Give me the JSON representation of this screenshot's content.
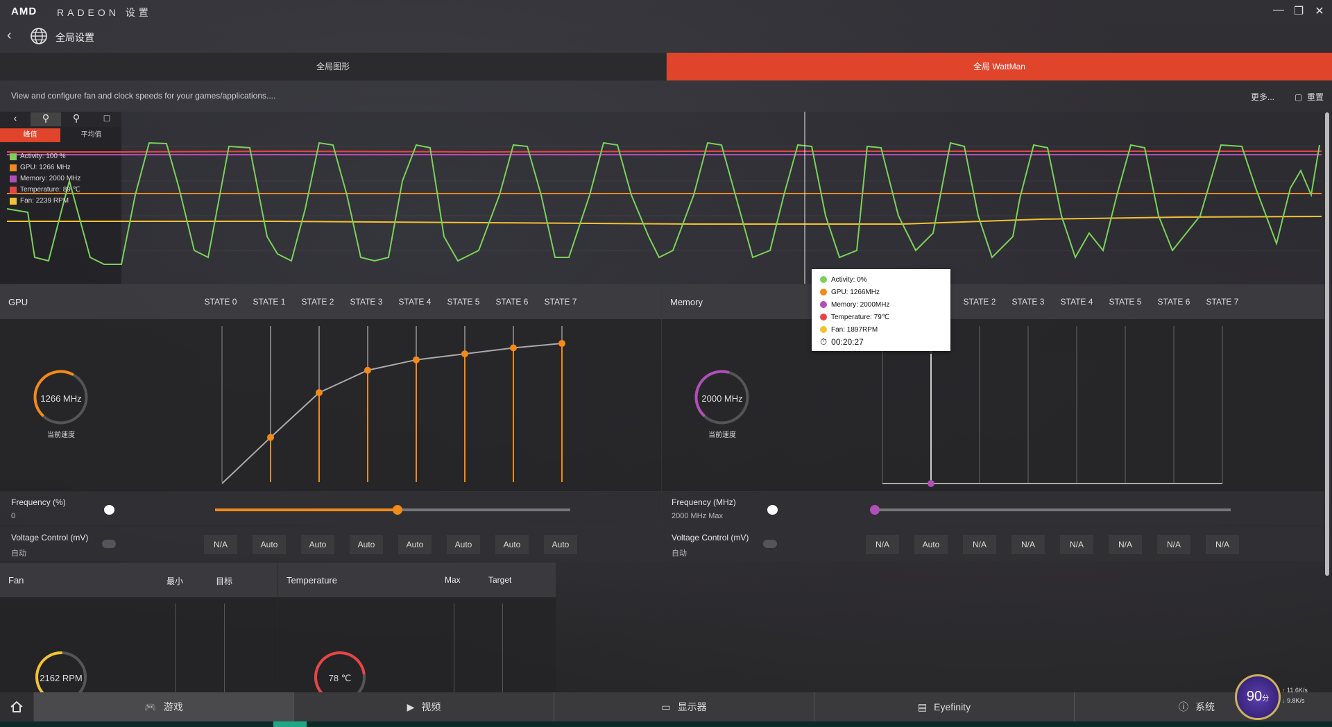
{
  "app": {
    "brand": "AMD",
    "name": "RADEON",
    "settings_label": "设置",
    "page_title": "全局设置"
  },
  "tabs": [
    {
      "label": "全局图形",
      "active": false
    },
    {
      "label": "全局 WattMan",
      "active": true
    }
  ],
  "description": "View and configure fan and clock speeds for your games/applications....",
  "toolbar": {
    "more": "更多...",
    "reset": "重置"
  },
  "graph": {
    "modes": [
      {
        "label": "峰值",
        "active": true
      },
      {
        "label": "平均值",
        "active": false
      }
    ],
    "legend": [
      {
        "label": "Activity: 100 %",
        "color": "#7bd15a"
      },
      {
        "label": "GPU: 1266 MHz",
        "color": "#f28a1a"
      },
      {
        "label": "Memory: 2000 MHz",
        "color": "#b04fb8"
      },
      {
        "label": "Temperature: 89 ℃",
        "color": "#e64545"
      },
      {
        "label": "Fan: 2239 RPM",
        "color": "#f2c232"
      }
    ],
    "tooltip": [
      {
        "label": "Activity: 0%",
        "color": "#7bd15a"
      },
      {
        "label": "GPU: 1266MHz",
        "color": "#f28a1a"
      },
      {
        "label": "Memory: 2000MHz",
        "color": "#b04fb8"
      },
      {
        "label": "Temperature: 79℃",
        "color": "#e64545"
      },
      {
        "label": "Fan: 1897RPM",
        "color": "#f2c232"
      }
    ],
    "tooltip_time": "00:20:27"
  },
  "gpu": {
    "title": "GPU",
    "states": [
      "STATE 0",
      "STATE 1",
      "STATE 2",
      "STATE 3",
      "STATE 4",
      "STATE 5",
      "STATE 6",
      "STATE 7"
    ],
    "gauge_value": "1266 MHz",
    "gauge_label": "当前速度",
    "gauge_fraction": 0.6,
    "frequency_label": "Frequency (%)",
    "frequency_value": "0",
    "voltage_label": "Voltage Control (mV)",
    "voltage_value": "自动",
    "voltage_buttons": [
      "N/A",
      "Auto",
      "Auto",
      "Auto",
      "Auto",
      "Auto",
      "Auto",
      "Auto"
    ]
  },
  "memory": {
    "title": "Memory",
    "states": [
      "STATE 2",
      "STATE 3",
      "STATE 4",
      "STATE 5",
      "STATE 6",
      "STATE 7"
    ],
    "gauge_value": "2000 MHz",
    "gauge_label": "当前速度",
    "gauge_fraction": 0.55,
    "frequency_label": "Frequency (MHz)",
    "frequency_value": "2000 MHz Max",
    "voltage_label": "Voltage Control (mV)",
    "voltage_value": "自动",
    "voltage_buttons": [
      "N/A",
      "Auto",
      "N/A",
      "N/A",
      "N/A",
      "N/A",
      "N/A",
      "N/A"
    ]
  },
  "fan": {
    "title": "Fan",
    "col_min": "最小",
    "col_target": "目标",
    "gauge_value": "2162 RPM",
    "gauge_fraction": 0.5
  },
  "temperature": {
    "title": "Temperature",
    "col_max": "Max",
    "col_target": "Target",
    "gauge_value": "78 ℃",
    "gauge_fraction": 0.8
  },
  "nav": [
    {
      "label": "游戏",
      "icon": "gamepad-icon",
      "active": true
    },
    {
      "label": "视频",
      "icon": "play-icon",
      "active": false
    },
    {
      "label": "显示器",
      "icon": "monitor-icon",
      "active": false
    },
    {
      "label": "Eyefinity",
      "icon": "eyefinity-icon",
      "active": false
    },
    {
      "label": "系统",
      "icon": "info-icon",
      "active": false
    }
  ],
  "widget": {
    "score": "90",
    "score_unit": "分",
    "upload": "11.6K/s",
    "download": "9.8K/s"
  }
}
